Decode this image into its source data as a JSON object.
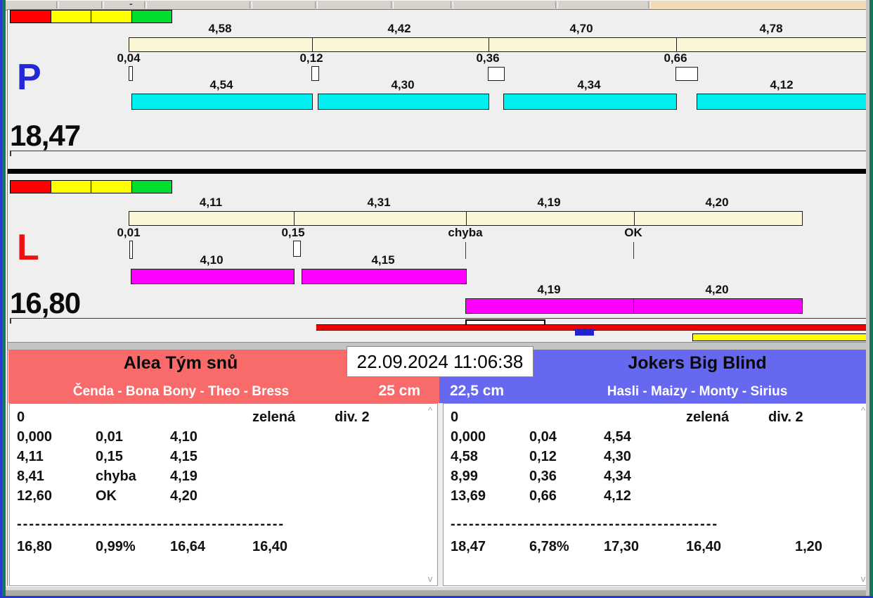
{
  "window": {
    "toolbar_minus": "-",
    "bg": "#F0EFEF",
    "frame_blue": "#2838D2",
    "frame_teal": "#11785F",
    "toolbar_peach": "#F3DAB6"
  },
  "traffic_lights": [
    "#FF0000",
    "#FFFF00",
    "#FFFF00",
    "#00DD2E"
  ],
  "lanes": {
    "p": {
      "id": "P",
      "id_color": "#2329D6",
      "total": "18,47",
      "splits": [
        "4,58",
        "4,42",
        "4,70",
        "4,78"
      ],
      "gaps": [
        "0,04",
        "0,12",
        "0,36",
        "0,66"
      ],
      "legs": [
        "4,54",
        "4,30",
        "4,34",
        "4,12"
      ],
      "ruler_color": "#FAF7D6",
      "bar_color": "#00EFEF"
    },
    "l": {
      "id": "L",
      "id_color": "#EE1111",
      "total": "16,80",
      "splits": [
        "4,11",
        "4,31",
        "4,19",
        "4,20"
      ],
      "gaps": [
        "0,01",
        "0,15",
        "chyba",
        "OK"
      ],
      "legs_row1": [
        "4,10",
        "4,15"
      ],
      "legs_row2": [
        "4,19",
        "4,20"
      ],
      "ruler_color": "#FAF7D6",
      "bar_color": "#FF00FF"
    }
  },
  "finish_strip": {
    "red": "#EE0000",
    "blue": "#2222CC",
    "yellow": "#FFFF00"
  },
  "timestamp": "22.09.2024 11:06:38",
  "teams": {
    "left": {
      "name": "Alea Tým snů",
      "members": "Čenda - Bona Bony - Theo - Bress",
      "distance": "25 cm",
      "accent": "#F96A6A",
      "header_row": {
        "num": "0",
        "color_word": "zelená",
        "division": "div. 2"
      },
      "laps": [
        {
          "cum": "0,000",
          "gap": "0,01",
          "split": "4,10"
        },
        {
          "cum": "4,11",
          "gap": "0,15",
          "split": "4,15"
        },
        {
          "cum": "8,41",
          "gap": "chyba",
          "split": "4,19"
        },
        {
          "cum": "12,60",
          "gap": "OK",
          "split": "4,20"
        }
      ],
      "divider": "--------------------------------------------",
      "totals": {
        "total": "16,80",
        "pct": "0,99%",
        "net": "16,64",
        "limit": "16,40",
        "diff": ""
      }
    },
    "right": {
      "name": "Jokers Big Blind",
      "members": "Hasli - Maizy - Monty - Sirius",
      "distance": "22,5 cm",
      "accent": "#6668EF",
      "header_row": {
        "num": "0",
        "color_word": "zelená",
        "division": "div. 2"
      },
      "laps": [
        {
          "cum": "0,000",
          "gap": "0,04",
          "split": "4,54"
        },
        {
          "cum": "4,58",
          "gap": "0,12",
          "split": "4,30"
        },
        {
          "cum": "8,99",
          "gap": "0,36",
          "split": "4,34"
        },
        {
          "cum": "13,69",
          "gap": "0,66",
          "split": "4,12"
        }
      ],
      "divider": "--------------------------------------------",
      "totals": {
        "total": "18,47",
        "pct": "6,78%",
        "net": "17,30",
        "limit": "16,40",
        "diff": "1,20"
      }
    }
  },
  "scrollbar": {
    "up_glyph": "^",
    "down_glyph": "v"
  }
}
